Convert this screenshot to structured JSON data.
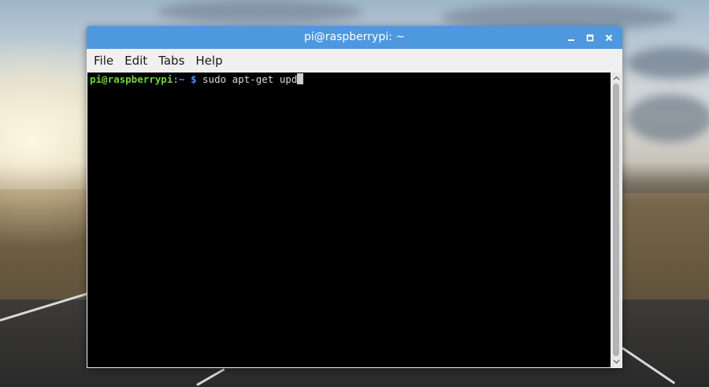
{
  "window": {
    "title": "pi@raspberrypi: ~",
    "titlebar_color": "#4d98df",
    "controls": {
      "minimize_icon": "minimize-icon",
      "maximize_icon": "maximize-icon",
      "close_icon": "close-icon"
    }
  },
  "menubar": {
    "items": [
      {
        "label": "File"
      },
      {
        "label": "Edit"
      },
      {
        "label": "Tabs"
      },
      {
        "label": "Help"
      }
    ]
  },
  "terminal": {
    "background": "#000000",
    "prompt_user": "pi@raspberrypi",
    "prompt_sep": ":",
    "prompt_path": "~",
    "prompt_symbol": "$",
    "command": "sudo apt-get upd"
  }
}
